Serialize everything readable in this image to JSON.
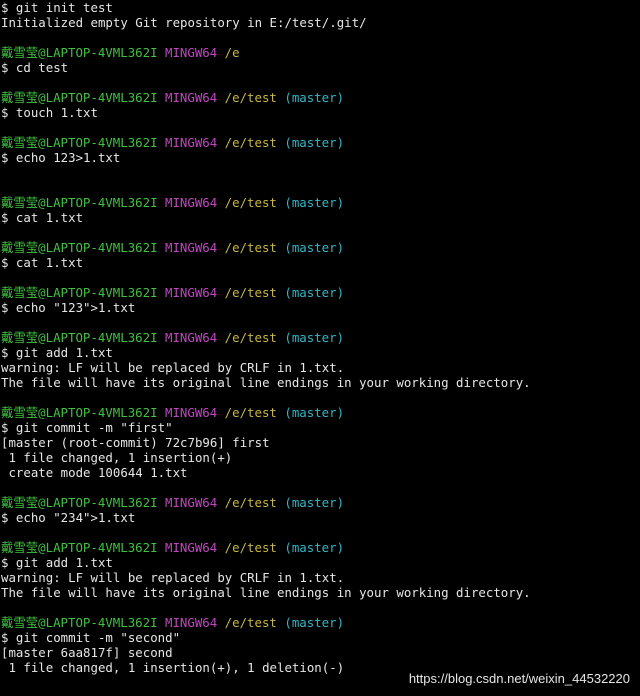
{
  "colors": {
    "background": "#000000",
    "user": "#3fc23f",
    "host": "#c046c0",
    "path": "#c8b83a",
    "branch": "#2fb7c8",
    "text": "#e6e6e6"
  },
  "prompt": {
    "user_host": "戴雪莹@LAPTOP-4VML362I",
    "shell": "MINGW64",
    "path_e": "/e",
    "path_test": "/e/test",
    "branch": "(master)"
  },
  "lines": [
    {
      "type": "cmd",
      "text": "$ git init test"
    },
    {
      "type": "out",
      "text": "Initialized empty Git repository in E:/test/.git/"
    },
    {
      "type": "blank"
    },
    {
      "type": "prompt",
      "path": "/e",
      "branch": ""
    },
    {
      "type": "cmd",
      "text": "$ cd test"
    },
    {
      "type": "blank"
    },
    {
      "type": "prompt",
      "path": "/e/test",
      "branch": "(master)"
    },
    {
      "type": "cmd",
      "text": "$ touch 1.txt"
    },
    {
      "type": "blank"
    },
    {
      "type": "prompt",
      "path": "/e/test",
      "branch": "(master)"
    },
    {
      "type": "cmd",
      "text": "$ echo 123>1.txt"
    },
    {
      "type": "blank"
    },
    {
      "type": "blank"
    },
    {
      "type": "prompt",
      "path": "/e/test",
      "branch": "(master)"
    },
    {
      "type": "cmd",
      "text": "$ cat 1.txt"
    },
    {
      "type": "blank"
    },
    {
      "type": "prompt",
      "path": "/e/test",
      "branch": "(master)"
    },
    {
      "type": "cmd",
      "text": "$ cat 1.txt"
    },
    {
      "type": "blank"
    },
    {
      "type": "prompt",
      "path": "/e/test",
      "branch": "(master)"
    },
    {
      "type": "cmd",
      "text": "$ echo \"123\">1.txt"
    },
    {
      "type": "blank"
    },
    {
      "type": "prompt",
      "path": "/e/test",
      "branch": "(master)"
    },
    {
      "type": "cmd",
      "text": "$ git add 1.txt"
    },
    {
      "type": "out",
      "text": "warning: LF will be replaced by CRLF in 1.txt."
    },
    {
      "type": "out",
      "text": "The file will have its original line endings in your working directory."
    },
    {
      "type": "blank"
    },
    {
      "type": "prompt",
      "path": "/e/test",
      "branch": "(master)"
    },
    {
      "type": "cmd",
      "text": "$ git commit -m \"first\""
    },
    {
      "type": "out",
      "text": "[master (root-commit) 72c7b96] first"
    },
    {
      "type": "out",
      "text": " 1 file changed, 1 insertion(+)"
    },
    {
      "type": "out",
      "text": " create mode 100644 1.txt"
    },
    {
      "type": "blank"
    },
    {
      "type": "prompt",
      "path": "/e/test",
      "branch": "(master)"
    },
    {
      "type": "cmd",
      "text": "$ echo \"234\">1.txt"
    },
    {
      "type": "blank"
    },
    {
      "type": "prompt",
      "path": "/e/test",
      "branch": "(master)"
    },
    {
      "type": "cmd",
      "text": "$ git add 1.txt"
    },
    {
      "type": "out",
      "text": "warning: LF will be replaced by CRLF in 1.txt."
    },
    {
      "type": "out",
      "text": "The file will have its original line endings in your working directory."
    },
    {
      "type": "blank"
    },
    {
      "type": "prompt",
      "path": "/e/test",
      "branch": "(master)"
    },
    {
      "type": "cmd",
      "text": "$ git commit -m \"second\""
    },
    {
      "type": "out",
      "text": "[master 6aa817f] second"
    },
    {
      "type": "out",
      "text": " 1 file changed, 1 insertion(+), 1 deletion(-)"
    }
  ],
  "watermark": "https://blog.csdn.net/weixin_44532220"
}
